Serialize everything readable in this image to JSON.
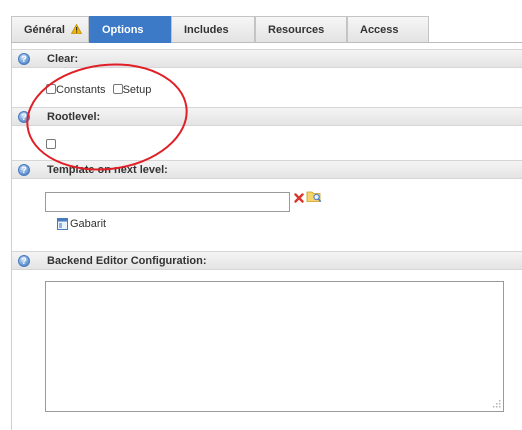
{
  "tabs": [
    {
      "label": "Général",
      "active": false,
      "has_warning": true
    },
    {
      "label": "Options",
      "active": true
    },
    {
      "label": "Includes",
      "active": false
    },
    {
      "label": "Resources",
      "active": false
    },
    {
      "label": "Access",
      "active": false
    }
  ],
  "sections": {
    "clear": {
      "title": "Clear:",
      "checkboxes": [
        {
          "label": "Constants",
          "checked": false
        },
        {
          "label": "Setup",
          "checked": false
        }
      ]
    },
    "rootlevel": {
      "title": "Rootlevel:",
      "checked": false
    },
    "template_next_level": {
      "title": "Template on next level:",
      "input_value": "",
      "item_label": "Gabarit"
    },
    "backend_editor": {
      "title": "Backend Editor Configuration:",
      "textarea_value": ""
    }
  },
  "colors": {
    "accent": "#3c79c7",
    "annotation_circle": "#e01f27",
    "warning": "#f2b705",
    "clear_icon": "#d9362b"
  }
}
